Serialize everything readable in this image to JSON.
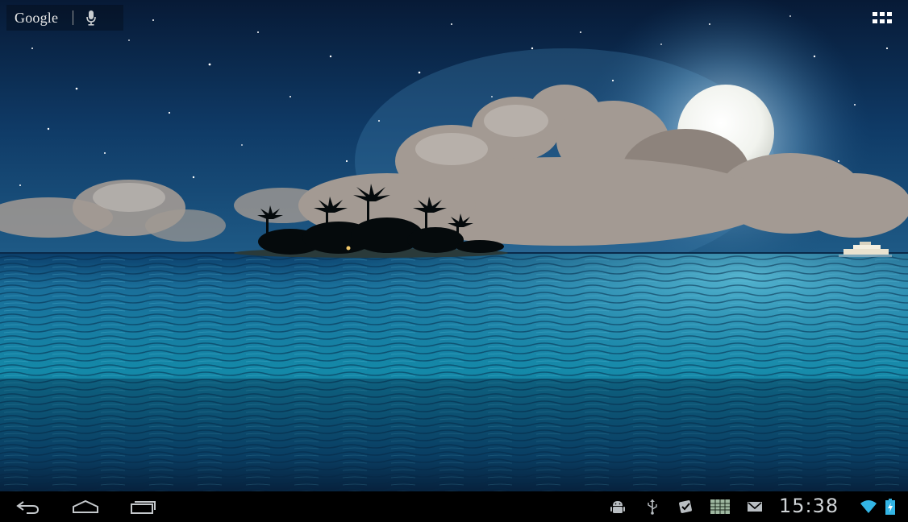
{
  "search": {
    "brand": "Google"
  },
  "icons": {
    "mic": "microphone-icon",
    "apps": "all-apps-grid-icon",
    "back": "back-arrow-icon",
    "home": "home-icon",
    "recents": "recent-apps-icon",
    "android_debug": "android-debug-icon",
    "usb": "usb-icon",
    "download_complete": "download-done-icon",
    "screenshot": "screenshot-icon",
    "gmail": "gmail-icon",
    "wifi": "wifi-icon",
    "battery": "battery-charging-icon"
  },
  "status_bar": {
    "time": "15:38"
  },
  "colors": {
    "status_icon": "#b9bec2",
    "wifi": "#33b5e5",
    "battery": "#33b5e5"
  }
}
